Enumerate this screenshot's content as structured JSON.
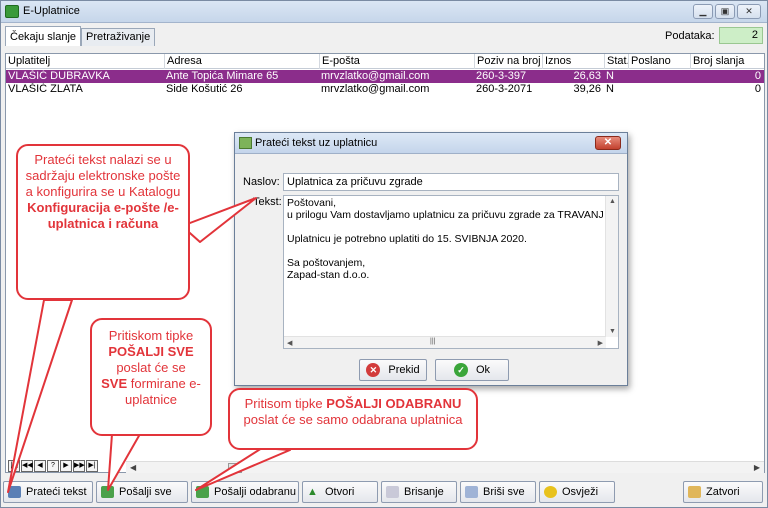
{
  "window": {
    "title": "E-Uplatnice"
  },
  "tabs": [
    {
      "label": "Čekaju slanje"
    },
    {
      "label": "Pretraživanje"
    }
  ],
  "count": {
    "label": "Podataka:",
    "value": "2"
  },
  "table": {
    "headers": [
      "Uplatitelj",
      "Adresa",
      "E-pošta",
      "Poziv na broj",
      "Iznos",
      "Stat.",
      "Poslano",
      "Broj slanja"
    ],
    "rows": [
      {
        "uplatitelj": "VLAŠIĆ DUBRAVKA",
        "adresa": "Ante Topića Mimare 65",
        "eposta": "mrvzlatko@gmail.com",
        "poziv": "260-3-397",
        "iznos": "26,63",
        "stat": "N",
        "poslano": "",
        "broj": "0"
      },
      {
        "uplatitelj": "VLAŠIĆ ZLATA",
        "adresa": "Side Košutić 26",
        "eposta": "mrvzlatko@gmail.com",
        "poziv": "260-3-2071",
        "iznos": "39,26",
        "stat": "N",
        "poslano": "",
        "broj": "0"
      }
    ]
  },
  "navigator": {
    "buttons": [
      "|◀",
      "◀◀",
      "◀",
      "?",
      "▶",
      "▶▶",
      "▶|"
    ]
  },
  "toolbar": {
    "prateci": "Prateći tekst",
    "posalji_sve": "Pošalji sve",
    "posalji_odabranu": "Pošalji odabranu",
    "otvori": "Otvori",
    "brisanje": "Brisanje",
    "brisi_sve": "Briši sve",
    "osvjezi": "Osvježi",
    "zatvori": "Zatvori"
  },
  "dialog": {
    "title": "Prateći tekst uz uplatnicu",
    "naslov_label": "Naslov:",
    "naslov_value": "Uplatnica za pričuvu zgrade",
    "tekst_label": "Tekst:",
    "tekst_lines": [
      "Poštovani,",
      " u prilogu Vam dostavljamo uplatnicu za pričuvu zgrade za TRAVANJ",
      "",
      "Uplatnicu je potrebno uplatiti do 15. SVIBNJA  2020.",
      "",
      "Sa poštovanjem,",
      "Zapad-stan d.o.o."
    ],
    "prekid": "Prekid",
    "ok": "Ok"
  },
  "callouts": {
    "c1_normal": "Prateći tekst nalazi se u sadržaju elektronske pošte a konfigurira se u Katalogu",
    "c1_bold": "Konfiguracija e-pošte /e-uplatnica i računa",
    "c2_pre": "Pritiskom tipke",
    "c2_bold1": "POŠALJI SVE",
    "c2_mid": "poslat će se",
    "c2_bold2": "SVE",
    "c2_post": "formirane e-uplatnice",
    "c3_pre": "Pritisom tipke",
    "c3_bold": "POŠALJI ODABRANU",
    "c3_post": " poslat će se samo odabrana uplatnica"
  },
  "colors": {
    "selected_row": "#8b2d8b",
    "callout": "#e2343a",
    "count_bg": "#cdeec7"
  }
}
